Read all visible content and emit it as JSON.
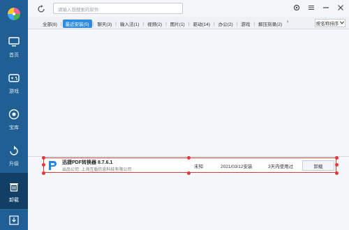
{
  "sidebar": {
    "logo": "pinwheel-logo",
    "items": [
      {
        "label": "首页",
        "icon": "monitor-icon",
        "active": false
      },
      {
        "label": "游戏",
        "icon": "gamepad-icon",
        "active": false
      },
      {
        "label": "宝库",
        "icon": "treasure-icon",
        "active": false
      },
      {
        "label": "升级",
        "icon": "upgrade-icon",
        "active": false
      },
      {
        "label": "卸载",
        "icon": "trash-icon",
        "active": true
      }
    ],
    "bottom_icon": "download-icon"
  },
  "topbar": {
    "search_placeholder": "请输入想搜索的软件",
    "window_buttons": [
      "settings-icon",
      "menu-icon",
      "minimize-icon",
      "close-icon"
    ]
  },
  "tabs": {
    "items": [
      {
        "label": "全部(8)",
        "active": false
      },
      {
        "label": "最近安装(5)",
        "active": true
      },
      {
        "label": "聊天(3)",
        "active": false
      },
      {
        "label": "输入法(1)",
        "active": false
      },
      {
        "label": "视频(2)",
        "active": false
      },
      {
        "label": "图片(1)",
        "active": false
      },
      {
        "label": "驱动(14)",
        "active": false
      },
      {
        "label": "办公(2)",
        "active": false
      },
      {
        "label": "游戏",
        "active": false
      },
      {
        "label": "解压刻录(2)",
        "active": false
      }
    ],
    "more_arrow": "›",
    "sort_label": "按名称排序"
  },
  "app_row": {
    "name": "迅捷PDF转换器 8.7.6.1",
    "publisher": "出品公司: 上海互盾信息科技有限公司",
    "size": "未知",
    "install_date": "2021/03/12安装",
    "usage": "3天内使用过",
    "uninstall_label": "卸载",
    "icon": "pdf-converter-icon",
    "highlight_color": "#e53935"
  }
}
